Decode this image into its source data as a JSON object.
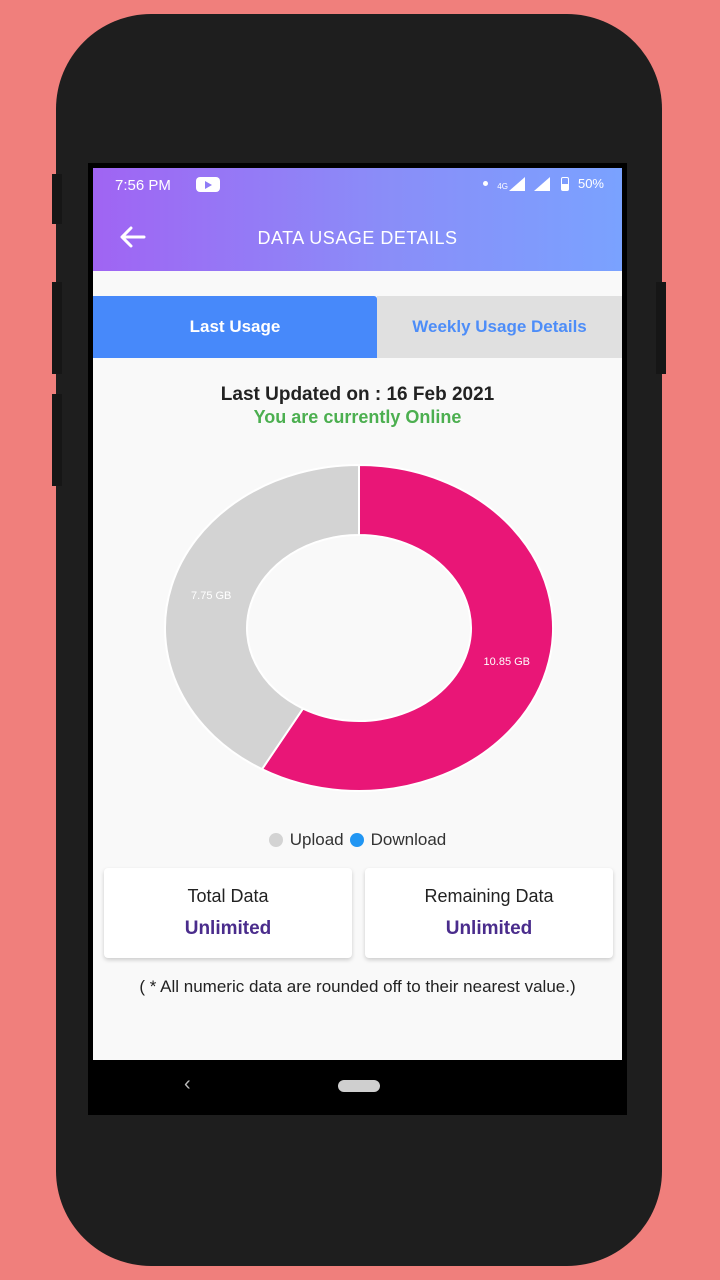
{
  "status_bar": {
    "time": "7:56 PM",
    "network": "4G",
    "battery": "50%"
  },
  "app_bar": {
    "title": "DATA USAGE DETAILS",
    "back_icon": "arrow-left-icon"
  },
  "tabs": [
    {
      "label": "Last Usage",
      "active": true
    },
    {
      "label": "Weekly Usage Details",
      "active": false
    }
  ],
  "info": {
    "last_updated": "Last Updated on : 16 Feb 2021",
    "status": "You are currently Online",
    "status_color": "#4caf50"
  },
  "chart_data": {
    "type": "pie",
    "donut": true,
    "categories": [
      "Upload",
      "Download"
    ],
    "values": [
      7.75,
      10.85
    ],
    "unit": "GB",
    "data_labels": [
      "7.75 GB",
      "10.85 GB"
    ],
    "colors": [
      "#d3d3d3",
      "#e91677"
    ],
    "legend": {
      "placement": "bottom",
      "entries": [
        "Upload",
        "Download"
      ],
      "colors": [
        "#d3d3d3",
        "#2196f3"
      ]
    }
  },
  "cards": [
    {
      "label": "Total Data",
      "value": "Unlimited"
    },
    {
      "label": "Remaining Data",
      "value": "Unlimited"
    }
  ],
  "note": "( * All numeric data are rounded off to their nearest value.)",
  "colors": {
    "accent": "#4789fa",
    "gradient_start": "#a064f3",
    "gradient_end": "#7aa2ff",
    "card_value": "#4a2c8c"
  }
}
